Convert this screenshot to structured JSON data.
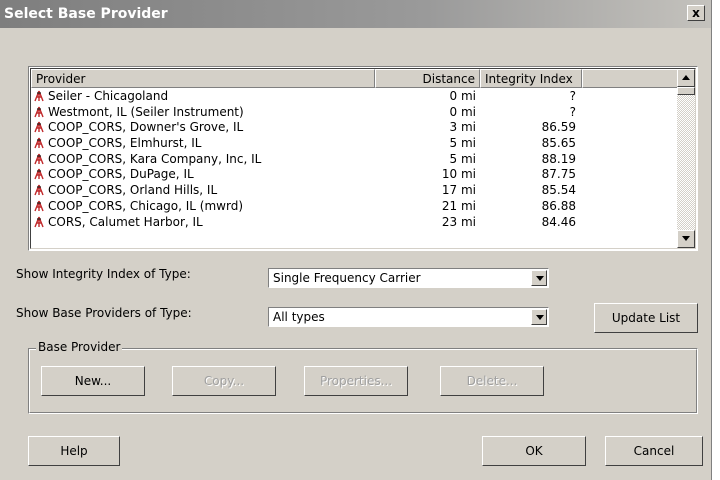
{
  "window": {
    "title": "Select Base Provider",
    "close_label": "x"
  },
  "list": {
    "columns": [
      "Provider",
      "Distance",
      "Integrity Index"
    ],
    "rows": [
      {
        "provider": "Seiler - Chicagoland",
        "distance": "0 mi",
        "integrity": "?"
      },
      {
        "provider": "Westmont, IL (Seiler Instrument)",
        "distance": "0 mi",
        "integrity": "?"
      },
      {
        "provider": "COOP_CORS, Downer's Grove, IL",
        "distance": "3 mi",
        "integrity": "86.59"
      },
      {
        "provider": "COOP_CORS, Elmhurst, IL",
        "distance": "5 mi",
        "integrity": "85.65"
      },
      {
        "provider": "COOP_CORS, Kara Company, Inc, IL",
        "distance": "5 mi",
        "integrity": "88.19"
      },
      {
        "provider": "COOP_CORS, DuPage, IL",
        "distance": "10 mi",
        "integrity": "87.75"
      },
      {
        "provider": "COOP_CORS, Orland Hills, IL",
        "distance": "17 mi",
        "integrity": "85.54"
      },
      {
        "provider": "COOP_CORS, Chicago, IL (mwrd)",
        "distance": "21 mi",
        "integrity": "86.88"
      },
      {
        "provider": "CORS, Calumet Harbor, IL",
        "distance": "23 mi",
        "integrity": "84.46"
      }
    ]
  },
  "filters": {
    "integrity_label": "Show Integrity Index of Type:",
    "integrity_value": "Single Frequency Carrier",
    "providers_label": "Show Base Providers of Type:",
    "providers_value": "All types",
    "update_button": "Update List"
  },
  "group": {
    "label": "Base Provider",
    "new": "New...",
    "copy": "Copy...",
    "properties": "Properties...",
    "delete": "Delete..."
  },
  "footer": {
    "help": "Help",
    "ok": "OK",
    "cancel": "Cancel"
  },
  "icons": {
    "provider": "antenna-icon",
    "close": "close-icon",
    "dropdown": "chevron-down-icon"
  },
  "colors": {
    "titlebar": "#8e8e8e",
    "face": "#d4d0c8",
    "antenna_red": "#c0282a"
  }
}
